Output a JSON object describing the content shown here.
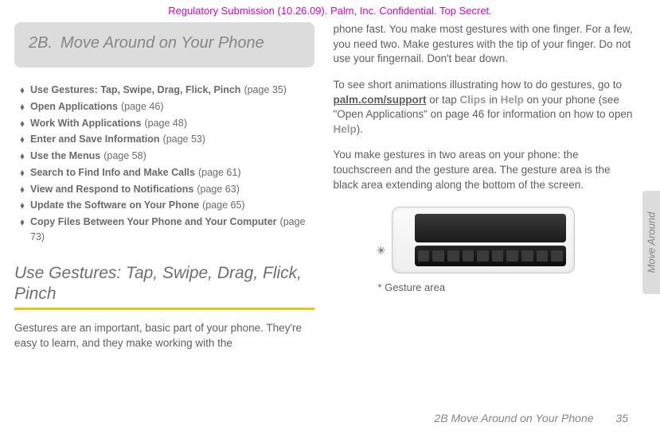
{
  "confidential": "Regulatory Submission (10.26.09). Palm, Inc. Confidential. Top Secret.",
  "section": {
    "number": "2B.",
    "title": "Move Around on Your Phone"
  },
  "toc": [
    {
      "label": "Use Gestures: Tap, Swipe, Drag, Flick, Pinch",
      "page": "(page 35)"
    },
    {
      "label": "Open Applications",
      "page": "(page 46)"
    },
    {
      "label": "Work With Applications",
      "page": "(page 48)"
    },
    {
      "label": "Enter and Save Information",
      "page": "(page 53)"
    },
    {
      "label": "Use the Menus",
      "page": "(page 58)"
    },
    {
      "label": "Search to Find Info and Make Calls",
      "page": "(page 61)"
    },
    {
      "label": "View and Respond to Notifications",
      "page": "(page 63)"
    },
    {
      "label": "Update the Software on Your Phone",
      "page": "(page 65)"
    },
    {
      "label": "Copy Files Between Your Phone and Your Computer",
      "page": "(page 73)"
    }
  ],
  "heading_use_gestures": "Use Gestures: Tap, Swipe, Drag, Flick, Pinch",
  "left_intro": "Gestures are an important, basic part of your phone. They're easy to learn, and they make working with the",
  "right": {
    "p1": "phone fast. You make most gestures with one finger. For a few, you need two. Make gestures with the tip of your finger. Do not use your fingernail. Don't bear down.",
    "p2_a": "To see short animations illustrating how to do gestures, go to ",
    "p2_link": "palm.com/support",
    "p2_b": " or tap ",
    "p2_clips": "Clips",
    "p2_c": " in ",
    "p2_help1": "Help",
    "p2_d": " on your phone (see \"Open Applications\" on page 46 for information on how to open ",
    "p2_help2": "Help",
    "p2_e": ").",
    "p3": "You make gestures in two areas on your phone: the touchscreen and the gesture area. The gesture area is the black area extending along the bottom of the screen."
  },
  "caption_label": "*   Gesture area",
  "side_tab": "Move Around",
  "footer": {
    "text": "2B Move Around on Your Phone",
    "page": "35"
  }
}
